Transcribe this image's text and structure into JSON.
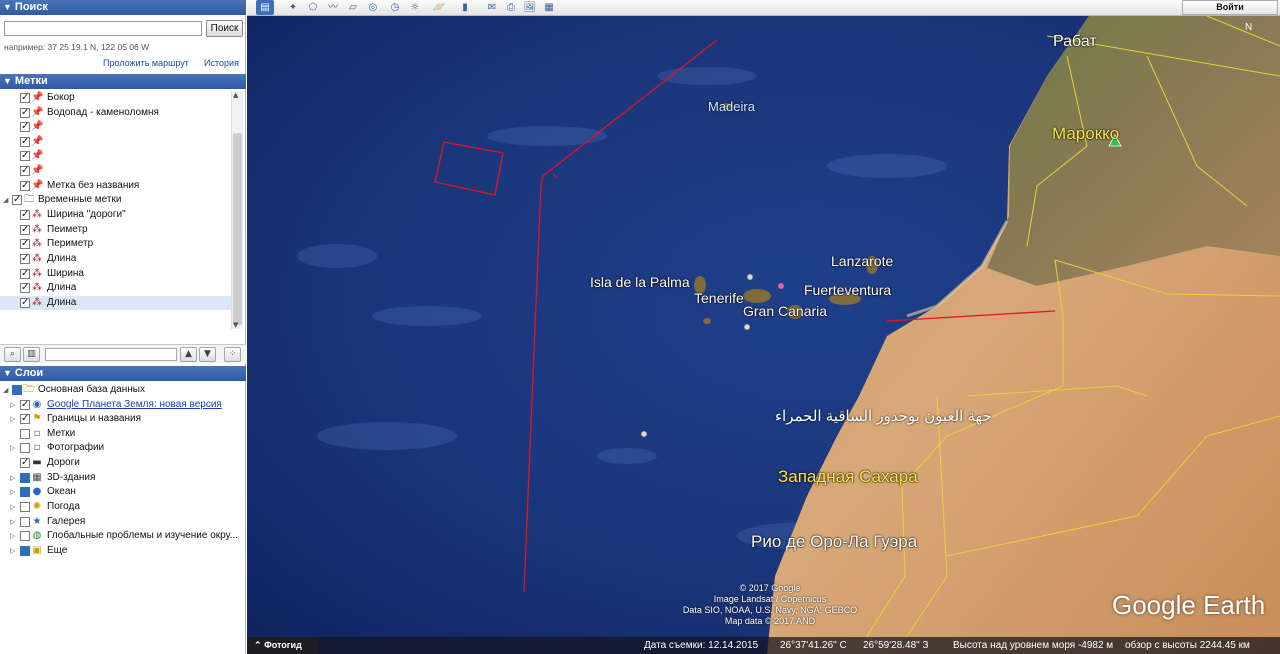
{
  "search": {
    "title": "Поиск",
    "button": "Поиск",
    "hint": "например: 37 25 19.1 N, 122 05 06 W",
    "route_link": "Проложить маршрут",
    "history_link": "История"
  },
  "places": {
    "title": "Метки",
    "items": [
      {
        "label": "Бокор"
      },
      {
        "label": "Водопад - каменоломня"
      },
      {
        "label": ""
      },
      {
        "label": ""
      },
      {
        "label": ""
      },
      {
        "label": ""
      },
      {
        "label": "Метка без названия"
      },
      {
        "label": "Временные метки"
      },
      {
        "label": "Ширина \"дороги\""
      },
      {
        "label": "Пеиметр"
      },
      {
        "label": "Периметр"
      },
      {
        "label": "Длина"
      },
      {
        "label": "Ширина"
      },
      {
        "label": "Длина"
      },
      {
        "label": "Длина"
      }
    ]
  },
  "layers": {
    "title": "Слои",
    "items": [
      {
        "label": "Основная база данных"
      },
      {
        "label": "Google Планета Земля: новая версия"
      },
      {
        "label": "Границы и названия"
      },
      {
        "label": "Метки"
      },
      {
        "label": "Фотографии"
      },
      {
        "label": "Дороги"
      },
      {
        "label": "3D-здания"
      },
      {
        "label": "Океан"
      },
      {
        "label": "Погода"
      },
      {
        "label": "Галерея"
      },
      {
        "label": "Глобальные проблемы и изучение окру..."
      },
      {
        "label": "Еще"
      }
    ]
  },
  "toolbar": {
    "signin": "Войти"
  },
  "map": {
    "labels": {
      "rabat": "Рабат",
      "morocco": "Марокко",
      "madeira": "Madeira",
      "lanzarote": "Lanzarote",
      "la_palma": "Isla de la Palma",
      "fuerteventura": "Fuerteventura",
      "tenerife": "Tenerife",
      "gran_canaria": "Gran Canaria",
      "arabic_region": "جهة العيون بوجدور الساقية الحمراء",
      "western_sahara": "Западная Сахара",
      "rio_de_oro": "Рио де Оро-Ла Гуэра"
    },
    "attribution": [
      "© 2017 Google",
      "Image Landsat / Copernicus",
      "Data SIO, NOAA, U.S. Navy, NGA, GEBCO",
      "Map data © 2017 AND"
    ],
    "brand": "Google Earth"
  },
  "status": {
    "photo_tab": "Фотогид",
    "date": "Дата съемки: 12.14.2015",
    "lat": "26°37'41.26\" С",
    "lon": "26°59'28.48\" З",
    "altitude": "Высота над уровнем моря -4982 м",
    "eye": "обзор с высоты 2244.45 км"
  }
}
